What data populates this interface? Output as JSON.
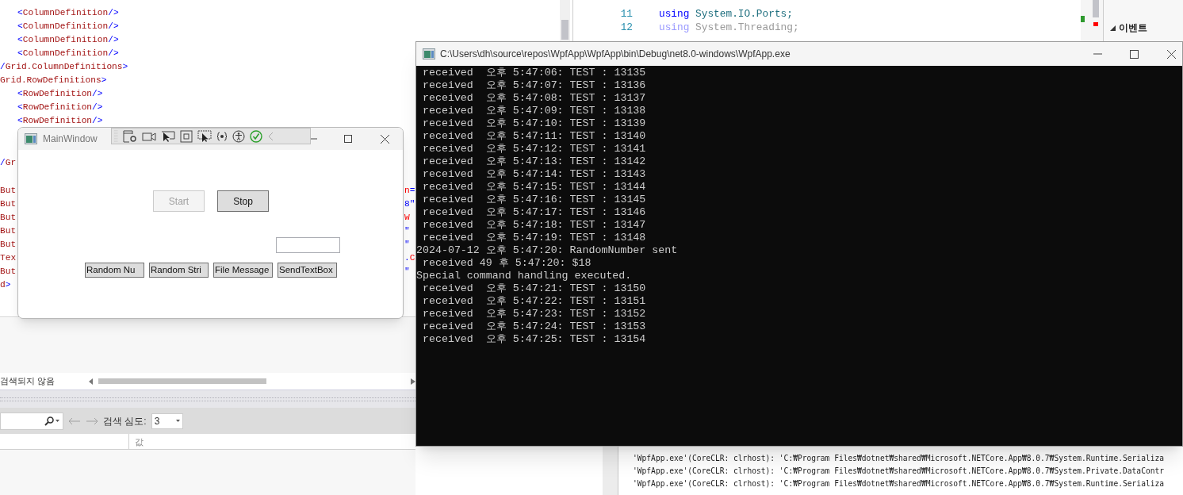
{
  "xaml_editor": {
    "lines": [
      {
        "kind": "child",
        "text": "<ColumnDefinition/>"
      },
      {
        "kind": "child",
        "text": "<ColumnDefinition/>"
      },
      {
        "kind": "child",
        "text": "<ColumnDefinition/>"
      },
      {
        "kind": "child",
        "text": "<ColumnDefinition/>"
      },
      {
        "kind": "parent",
        "text": "/Grid.ColumnDefinitions>"
      },
      {
        "kind": "parent",
        "text": "Grid.RowDefinitions>"
      },
      {
        "kind": "child",
        "text": "<RowDefinition/>"
      },
      {
        "kind": "child",
        "text": "<RowDefinition/>"
      },
      {
        "kind": "child",
        "text": "<RowDefinition/>"
      }
    ],
    "closing_fragment": "/Gr",
    "fragments": [
      {
        "left": "But",
        "right": "n="
      },
      {
        "left": "But",
        "right": "8\""
      },
      {
        "left": "But",
        "right": "W"
      },
      {
        "left": "But",
        "right": "\""
      },
      {
        "left": "But",
        "right": "\""
      },
      {
        "left": "Tex",
        "right": ".C"
      },
      {
        "left": "But",
        "right": "\""
      },
      {
        "left": "d>"
      }
    ]
  },
  "properties_panel": {
    "status": "검색되지 않음",
    "depth_label": "검색 심도:",
    "depth_value": "3",
    "column_header": "값"
  },
  "code_editor": {
    "lines": [
      {
        "number": "11",
        "keyword": "using",
        "text": "System.IO.Ports;",
        "dimmed": false
      },
      {
        "number": "12",
        "keyword": "using",
        "text": "System.Threading;",
        "dimmed": true
      }
    ]
  },
  "side_panel": {
    "section": "이벤트",
    "expanded": true
  },
  "main_window": {
    "title": "MainWindow",
    "buttons": [
      {
        "label": "Start",
        "disabled": true
      },
      {
        "label": "Stop",
        "disabled": false
      }
    ],
    "action_buttons": [
      "Random Nu",
      "Random Stri",
      "File Message",
      "SendTextBox"
    ]
  },
  "console_window": {
    "title": "C:\\Users\\dh\\source\\repos\\WpfApp\\WpfApp\\bin\\Debug\\net8.0-windows\\WpfApp.exe",
    "lines": [
      " received  오후 5:47:06: TEST : 13135",
      " received  오후 5:47:07: TEST : 13136",
      " received  오후 5:47:08: TEST : 13137",
      " received  오후 5:47:09: TEST : 13138",
      " received  오후 5:47:10: TEST : 13139",
      " received  오후 5:47:11: TEST : 13140",
      " received  오후 5:47:12: TEST : 13141",
      " received  오후 5:47:13: TEST : 13142",
      " received  오후 5:47:14: TEST : 13143",
      " received  오후 5:47:15: TEST : 13144",
      " received  오후 5:47:16: TEST : 13145",
      " received  오후 5:47:17: TEST : 13146",
      " received  오후 5:47:18: TEST : 13147",
      " received  오후 5:47:19: TEST : 13148",
      "2024-07-12 오후 5:47:20: RandomNumber sent",
      " received 49 후 5:47:20: $18",
      "Special command handling executed.",
      " received  오후 5:47:21: TEST : 13150",
      " received  오후 5:47:22: TEST : 13151",
      " received  오후 5:47:23: TEST : 13152",
      " received  오후 5:47:24: TEST : 13153",
      " received  오후 5:47:25: TEST : 13154"
    ]
  },
  "output": {
    "lines": [
      "'WpfApp.exe'(CoreCLR: clrhost): 'C:₩Program Files₩dotnet₩shared₩Microsoft.NETCore.App₩8.0.7₩System.Runtime.Serializa",
      "'WpfApp.exe'(CoreCLR: clrhost): 'C:₩Program Files₩dotnet₩shared₩Microsoft.NETCore.App₩8.0.7₩System.Private.DataContr",
      "'WpfApp.exe'(CoreCLR: clrhost): 'C:₩Program Files₩dotnet₩shared₩Microsoft.NETCore.App₩8.0.7₩System.Runtime.Serializa"
    ]
  }
}
